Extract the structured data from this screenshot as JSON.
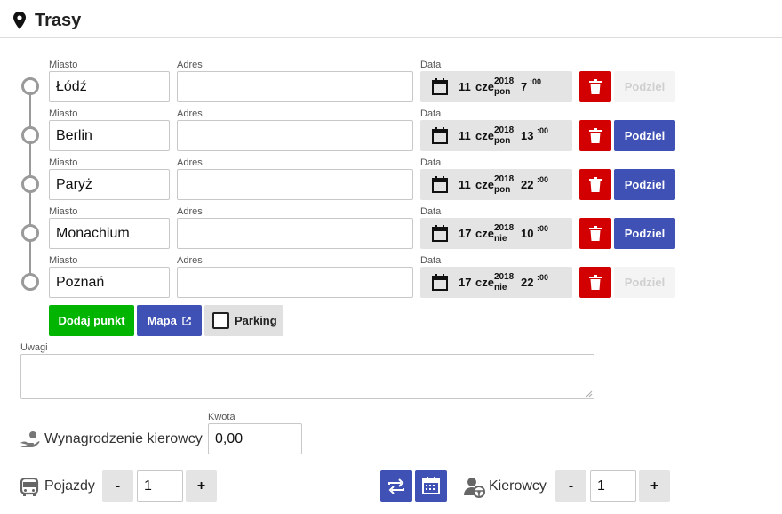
{
  "header": {
    "title": "Trasy",
    "icon": "map-pin-icon"
  },
  "labels": {
    "city": "Miasto",
    "address": "Adres",
    "date": "Data"
  },
  "points": [
    {
      "city": "Łódź",
      "address": "",
      "day": "11",
      "month": "cze",
      "year": "2018",
      "weekday": "pon",
      "hour": "7",
      "minute": ":00",
      "split": "Podziel",
      "split_enabled": false
    },
    {
      "city": "Berlin",
      "address": "",
      "day": "11",
      "month": "cze",
      "year": "2018",
      "weekday": "pon",
      "hour": "13",
      "minute": ":00",
      "split": "Podziel",
      "split_enabled": true
    },
    {
      "city": "Paryż",
      "address": "",
      "day": "11",
      "month": "cze",
      "year": "2018",
      "weekday": "pon",
      "hour": "22",
      "minute": ":00",
      "split": "Podziel",
      "split_enabled": true
    },
    {
      "city": "Monachium",
      "address": "",
      "day": "17",
      "month": "cze",
      "year": "2018",
      "weekday": "nie",
      "hour": "10",
      "minute": ":00",
      "split": "Podziel",
      "split_enabled": true
    },
    {
      "city": "Poznań",
      "address": "",
      "day": "17",
      "month": "cze",
      "year": "2018",
      "weekday": "nie",
      "hour": "22",
      "minute": ":00",
      "split": "Podziel",
      "split_enabled": false
    }
  ],
  "actions": {
    "add_point": "Dodaj punkt",
    "map": "Mapa",
    "parking": "Parking",
    "parking_checked": false
  },
  "notes": {
    "label": "Uwagi",
    "value": ""
  },
  "pay": {
    "label": "Wynagrodzenie kierowcy",
    "amount_label": "Kwota",
    "amount": "0,00"
  },
  "vehicles": {
    "label": "Pojazdy",
    "minus": "-",
    "plus": "+",
    "value": "1"
  },
  "drivers": {
    "label": "Kierowcy",
    "minus": "-",
    "plus": "+",
    "value": "1"
  },
  "colors": {
    "accent": "#3f51b5",
    "danger": "#d20000",
    "success": "#00b400"
  }
}
